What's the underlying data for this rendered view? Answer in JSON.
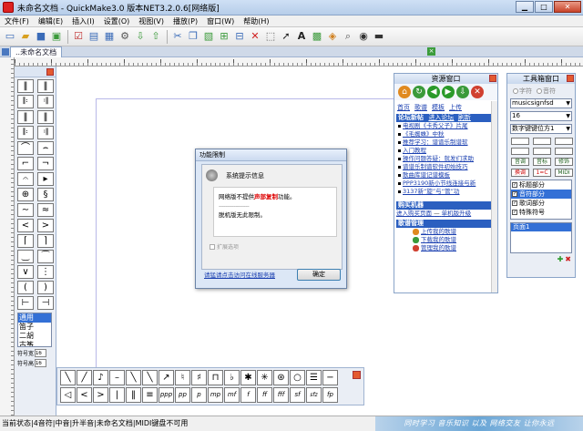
{
  "window": {
    "title": "未命名文档 - QuickMake3.0 版本NET3.2.0.6[网络版]"
  },
  "menu": [
    "文件(F)",
    "编辑(E)",
    "插入(I)",
    "设置(O)",
    "视图(V)",
    "播放(P)",
    "窗口(W)",
    "帮助(H)"
  ],
  "document_tab": {
    "label": "..未命名文档"
  },
  "symbol_panel": {
    "list": [
      "通用",
      "笛子",
      "二胡",
      "古筝"
    ],
    "size_label": "符号宽",
    "size_value": "16",
    "height_label": "符号高",
    "height_value": "16"
  },
  "resource_window": {
    "title": "资源窗口",
    "tabs": [
      "首页",
      "歌谱",
      "模板",
      "上传"
    ],
    "forum_header": "论坛新帖",
    "forum_enter": "进入论坛",
    "forum_refresh": "刷新",
    "links": [
      "电视剧《卡秀父子》片尾",
      "《毛蜘蛛》中秋",
      "推荐学习：谱谱乐制谱软",
      "入门教程",
      "操作问题答疑：就发们求助",
      "谱谱乐制谱软件初始技巧",
      "歌曲库谱记谱模板",
      "PPP3190新小节线连接与新",
      "3137新“旋”与“管”功"
    ],
    "buy_header": "购买机器",
    "buy_link": "进入购买页面",
    "buy_upgrade": "单机版升级",
    "score_header": "歌谱管理",
    "score_items": [
      "上传我的歌谱",
      "下载我的歌谱",
      "管理我的歌谱"
    ]
  },
  "tool_window": {
    "title": "工具箱窗口",
    "radio_text": "字符",
    "radio_music": "音符",
    "font_select": "musicsignfsd",
    "size_select": "16",
    "align_select": "数字键键位方1",
    "buttons_row1": [
      "音调",
      "音标",
      "修饰"
    ],
    "buttons_row2": [
      "换调",
      "1=C",
      "MIDI"
    ],
    "checklist": [
      {
        "label": "标题部分",
        "checked": true,
        "selected": false
      },
      {
        "label": "音符部分",
        "checked": true,
        "selected": true
      },
      {
        "label": "歌词部分",
        "checked": true,
        "selected": false
      },
      {
        "label": "特殊符号",
        "checked": true,
        "selected": false
      }
    ],
    "page_list": [
      "页面1"
    ]
  },
  "dialog": {
    "title": "功能限制",
    "heading": "系统提示信息",
    "msg_prefix": "网络版不提供",
    "msg_highlight": "声部复制",
    "msg_suffix": "功能。",
    "dots": "------------------",
    "msg_offline": "脱机版无此限制。",
    "expand_label": "扩展选项",
    "link": "请猛请点击访问在线服务器",
    "ok_label": "确定"
  },
  "status": {
    "text": "当前状态|4音符|中音|升半音|未命名文档|MIDI键盘不可用",
    "banner": "同时学习 音乐知识 以及 网络交友 让你永远"
  },
  "colors": {
    "accent": "#3370d6",
    "link": "#1a3fb0",
    "forum_header": "#2b5fc0",
    "highlight": "#d00000"
  }
}
